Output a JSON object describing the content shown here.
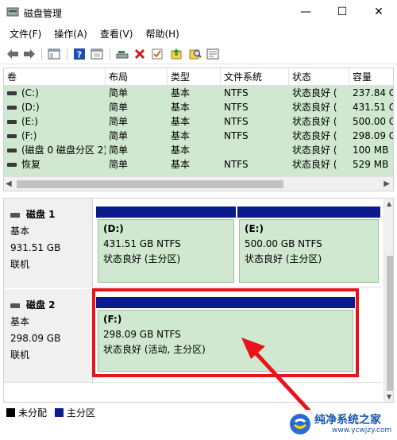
{
  "window": {
    "title": "磁盘管理",
    "minimize": "—",
    "maximize": "☐",
    "close": "✕"
  },
  "menu": [
    "文件(F)",
    "操作(A)",
    "查看(V)",
    "帮助(H)"
  ],
  "toolbar": {
    "icons": [
      "back-icon",
      "forward-icon",
      "show-hide-console-icon",
      "help-icon",
      "properties-icon",
      "connect-disk-icon",
      "delete-icon",
      "check-icon",
      "import-icon",
      "search-icon",
      "details-icon"
    ]
  },
  "volume_list": {
    "columns": [
      "卷",
      "布局",
      "类型",
      "文件系统",
      "状态",
      "容量"
    ],
    "rows": [
      {
        "volume": "(C:)",
        "layout": "简单",
        "type": "基本",
        "fs": "NTFS",
        "status": "状态良好 (",
        "capacity": "237.84 G"
      },
      {
        "volume": "(D:)",
        "layout": "简单",
        "type": "基本",
        "fs": "NTFS",
        "status": "状态良好 (",
        "capacity": "431.51 G"
      },
      {
        "volume": "(E:)",
        "layout": "简单",
        "type": "基本",
        "fs": "NTFS",
        "status": "状态良好 (",
        "capacity": "500.00 G"
      },
      {
        "volume": "(F:)",
        "layout": "简单",
        "type": "基本",
        "fs": "NTFS",
        "status": "状态良好 (",
        "capacity": "298.09 G"
      },
      {
        "volume": "(磁盘 0 磁盘分区 2)",
        "layout": "简单",
        "type": "基本",
        "fs": "",
        "status": "状态良好 (",
        "capacity": "100 MB"
      },
      {
        "volume": "恢复",
        "layout": "简单",
        "type": "基本",
        "fs": "NTFS",
        "status": "状态良好 (",
        "capacity": "529 MB"
      }
    ]
  },
  "disks": [
    {
      "name": "磁盘 1",
      "kind": "基本",
      "size": "931.51 GB",
      "state": "联机",
      "partitions": [
        {
          "title": "(D:)",
          "size": "431.51 GB NTFS",
          "status": "状态良好 (主分区)"
        },
        {
          "title": "(E:)",
          "size": "500.00 GB NTFS",
          "status": "状态良好 (主分区)"
        }
      ]
    },
    {
      "name": "磁盘 2",
      "kind": "基本",
      "size": "298.09 GB",
      "state": "联机",
      "partitions": [
        {
          "title": "(F:)",
          "size": "298.09 GB NTFS",
          "status": "状态良好 (活动, 主分区)"
        }
      ]
    }
  ],
  "legend": [
    {
      "label": "未分配",
      "color": "#000000"
    },
    {
      "label": "主分区",
      "color": "#0b1a8c"
    }
  ],
  "colors": {
    "partition_header": "#0b1a8c",
    "partition_fill": "#cfe8cf",
    "highlight": "#e8141c"
  },
  "watermark": {
    "text": "纯净系统之家",
    "url": "www.ycwjzy.com"
  }
}
